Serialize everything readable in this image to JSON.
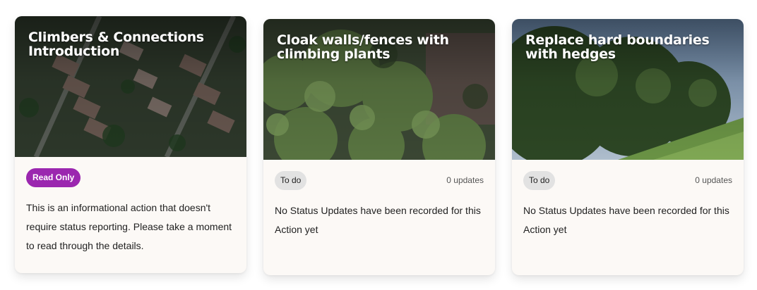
{
  "cards": [
    {
      "title": "Climbers & Connections Introduction",
      "badge": "Read Only",
      "body_text": "This is an informational action that doesn't require status reporting. Please take a moment to read through the details.",
      "colors": {
        "badge_bg": "#9b27af",
        "card_bg": "#fcf9f6"
      }
    },
    {
      "title": "Cloak walls/fences with climbing plants",
      "status": "To do",
      "updates": "0 updates",
      "body_text": "No Status Updates have been recorded for this Action yet"
    },
    {
      "title": "Replace hard boundaries with hedges",
      "status": "To do",
      "updates": "0 updates",
      "body_text": "No Status Updates have been recorded for this Action yet"
    }
  ]
}
